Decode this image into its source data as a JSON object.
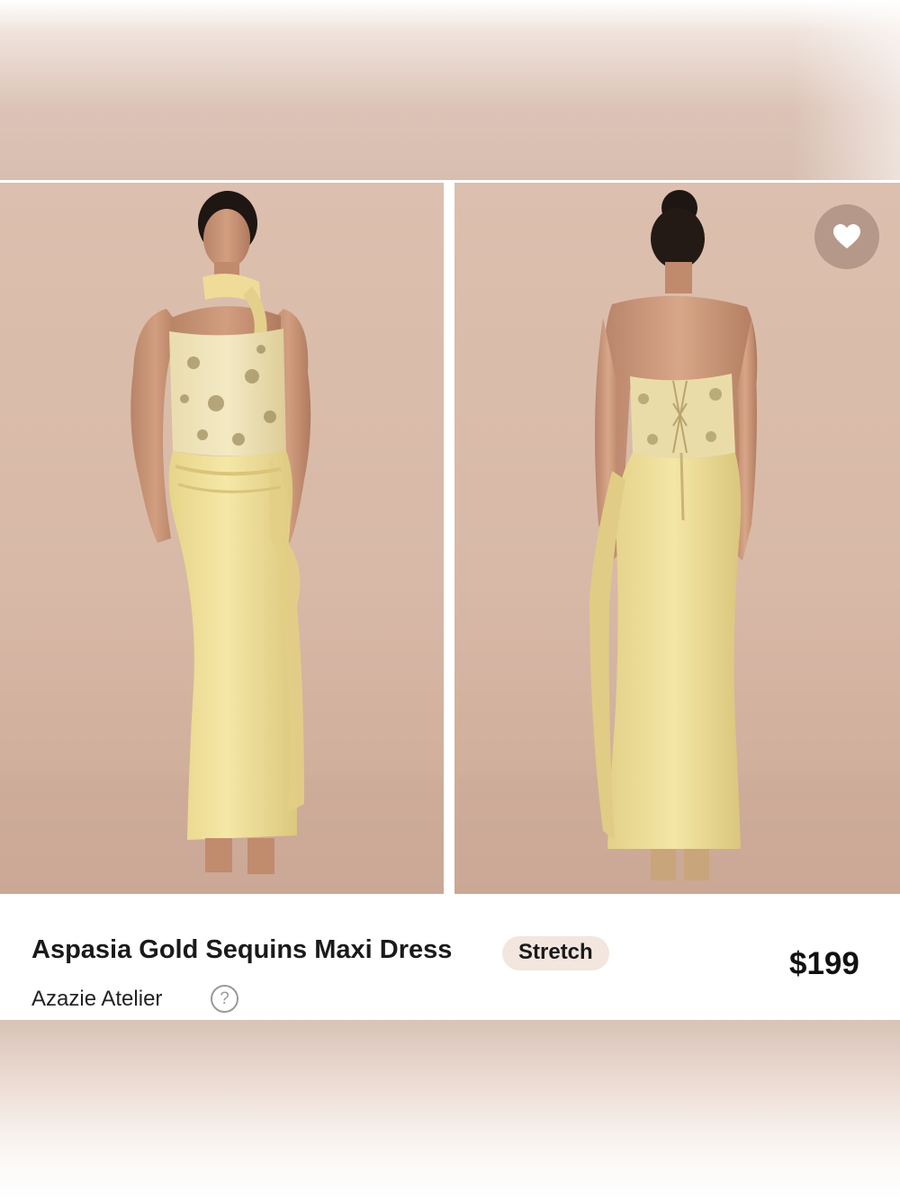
{
  "product": {
    "title": "Aspasia Gold Sequins Maxi Dress",
    "badge": "Stretch",
    "brand": "Azazie Atelier",
    "help_icon": "?",
    "price": "$199"
  },
  "gallery": {
    "images": [
      "front view",
      "back view"
    ]
  },
  "icons": {
    "favorite": "heart-icon",
    "help": "question-circle-icon"
  },
  "colors": {
    "background_tone": "#d8b9a7",
    "dress": "#f1e39c",
    "badge_bg": "#f2e6de",
    "text": "#1a1a1a"
  }
}
